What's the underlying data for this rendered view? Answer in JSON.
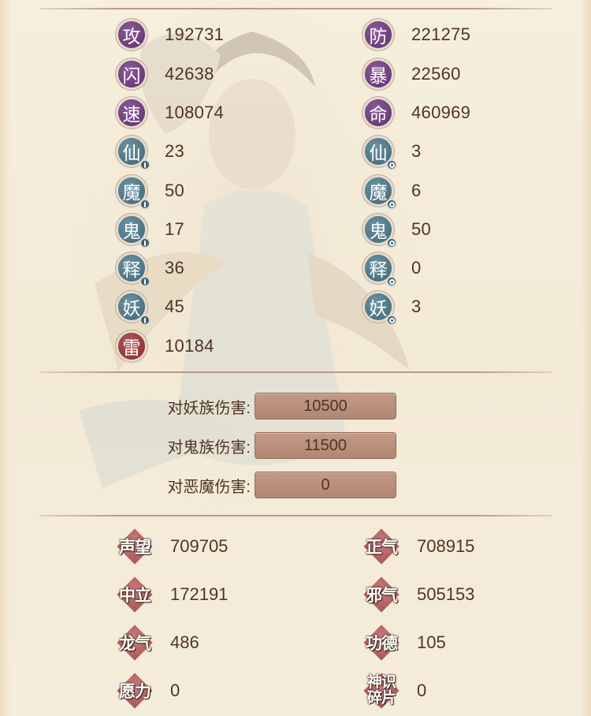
{
  "stats_left": [
    {
      "label": "攻",
      "value": "192731",
      "color": "purple"
    },
    {
      "label": "闪",
      "value": "42638",
      "color": "purple"
    },
    {
      "label": "速",
      "value": "108074",
      "color": "purple"
    },
    {
      "label": "仙",
      "value": "23",
      "color": "teal",
      "marker": "attack"
    },
    {
      "label": "魔",
      "value": "50",
      "color": "teal",
      "marker": "attack"
    },
    {
      "label": "鬼",
      "value": "17",
      "color": "teal",
      "marker": "attack"
    },
    {
      "label": "释",
      "value": "36",
      "color": "teal",
      "marker": "attack"
    },
    {
      "label": "妖",
      "value": "45",
      "color": "teal",
      "marker": "attack"
    },
    {
      "label": "雷",
      "value": "10184",
      "color": "red"
    }
  ],
  "stats_right": [
    {
      "label": "防",
      "value": "221275",
      "color": "purple"
    },
    {
      "label": "暴",
      "value": "22560",
      "color": "purple"
    },
    {
      "label": "命",
      "value": "460969",
      "color": "purple"
    },
    {
      "label": "仙",
      "value": "3",
      "color": "teal",
      "marker": "defense"
    },
    {
      "label": "魔",
      "value": "6",
      "color": "teal",
      "marker": "defense"
    },
    {
      "label": "鬼",
      "value": "50",
      "color": "teal",
      "marker": "defense"
    },
    {
      "label": "释",
      "value": "0",
      "color": "teal",
      "marker": "defense"
    },
    {
      "label": "妖",
      "value": "3",
      "color": "teal",
      "marker": "defense"
    }
  ],
  "damage": [
    {
      "label": "对妖族伤害:",
      "value": "10500"
    },
    {
      "label": "对鬼族伤害:",
      "value": "11500"
    },
    {
      "label": "对恶魔伤害:",
      "value": "0"
    }
  ],
  "reputation_left": [
    {
      "label": "声望",
      "value": "709705"
    },
    {
      "label": "中立",
      "value": "172191"
    },
    {
      "label": "龙气",
      "value": "486"
    },
    {
      "label": "愿力",
      "value": "0"
    }
  ],
  "reputation_right": [
    {
      "label": "正气",
      "value": "708915"
    },
    {
      "label": "邪气",
      "value": "505153"
    },
    {
      "label": "功德",
      "value": "105"
    },
    {
      "label": "神识碎片",
      "value": "0"
    }
  ],
  "colors": {
    "purple": "#6e3f7c",
    "teal": "#4c7685",
    "red": "#92343a",
    "text": "#4f3424",
    "bar": "#b8917d"
  }
}
